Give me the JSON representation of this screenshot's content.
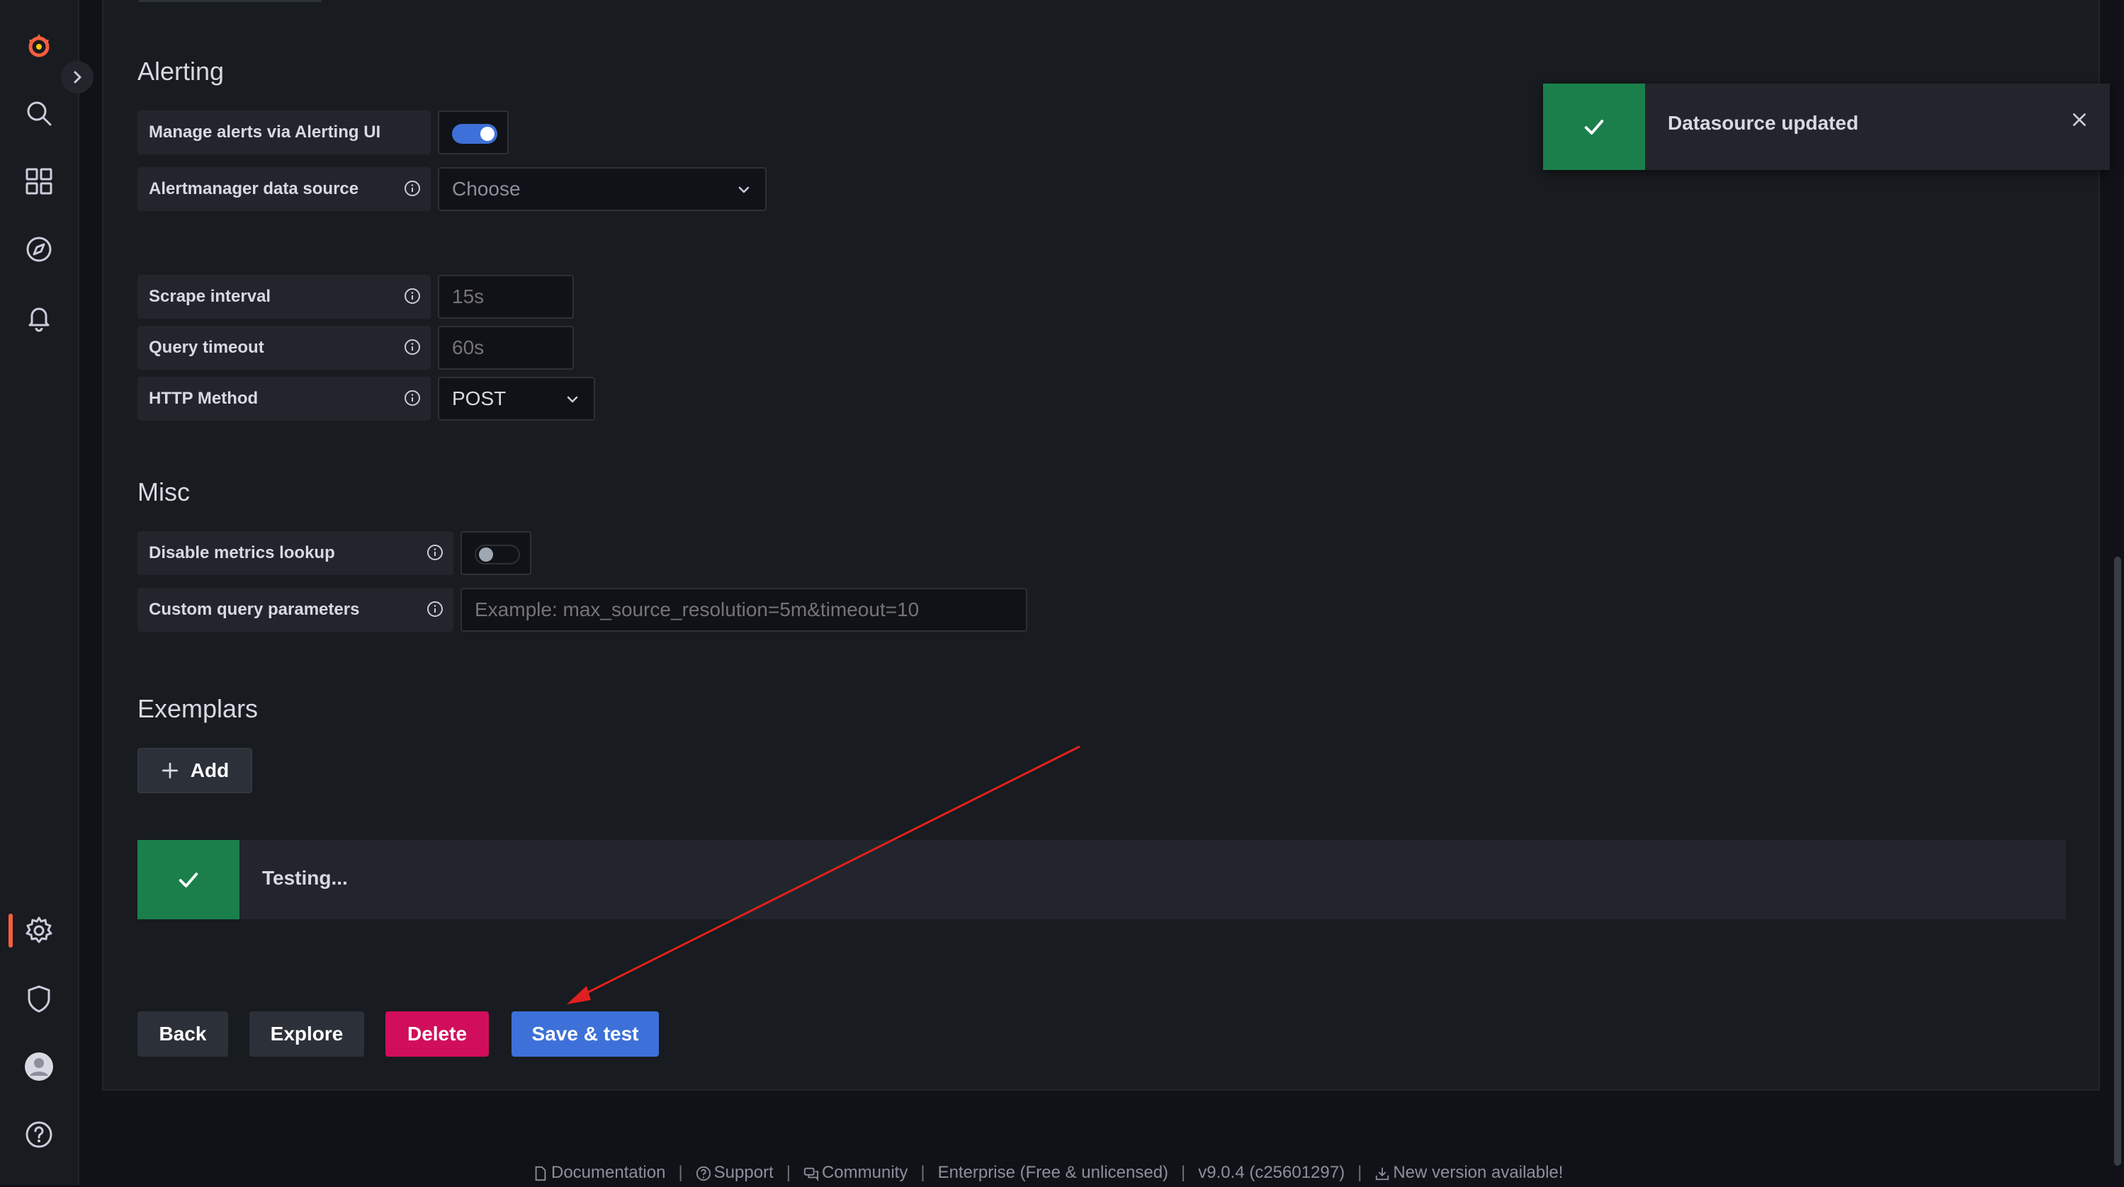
{
  "toast": {
    "message": "Datasource updated"
  },
  "alerting": {
    "title": "Alerting",
    "manage_alerts_label": "Manage alerts via Alerting UI",
    "manage_alerts_enabled": true,
    "alertmanager_label": "Alertmanager data source",
    "alertmanager_placeholder": "Choose"
  },
  "http": {
    "scrape_interval_label": "Scrape interval",
    "scrape_interval_placeholder": "15s",
    "query_timeout_label": "Query timeout",
    "query_timeout_placeholder": "60s",
    "http_method_label": "HTTP Method",
    "http_method_value": "POST"
  },
  "misc": {
    "title": "Misc",
    "disable_metrics_label": "Disable metrics lookup",
    "disable_metrics_enabled": false,
    "custom_query_label": "Custom query parameters",
    "custom_query_placeholder": "Example: max_source_resolution=5m&timeout=10"
  },
  "exemplars": {
    "title": "Exemplars",
    "add_label": "Add"
  },
  "status": {
    "message": "Testing..."
  },
  "actions": {
    "back": "Back",
    "explore": "Explore",
    "delete": "Delete",
    "save_test": "Save & test"
  },
  "footer": {
    "documentation": "Documentation",
    "support": "Support",
    "community": "Community",
    "edition": "Enterprise (Free & unlicensed)",
    "version": "v9.0.4 (c25601297)",
    "new_version": "New version available!"
  },
  "colors": {
    "success": "#1a7f4b",
    "primary": "#3d71d9",
    "destructive": "#d10e5c",
    "annotation_arrow": "#e02020",
    "brand": "#f55f3e"
  },
  "icons": [
    "grafana-logo-icon",
    "search-icon",
    "dashboards-icon",
    "explore-icon",
    "alerting-bell-icon",
    "gear-icon",
    "shield-icon",
    "avatar",
    "help-icon",
    "chevron-right-icon",
    "info-icon",
    "chevron-down-icon",
    "check-icon",
    "close-icon",
    "plus-icon",
    "document-icon",
    "question-icon",
    "comments-icon",
    "download-icon"
  ]
}
